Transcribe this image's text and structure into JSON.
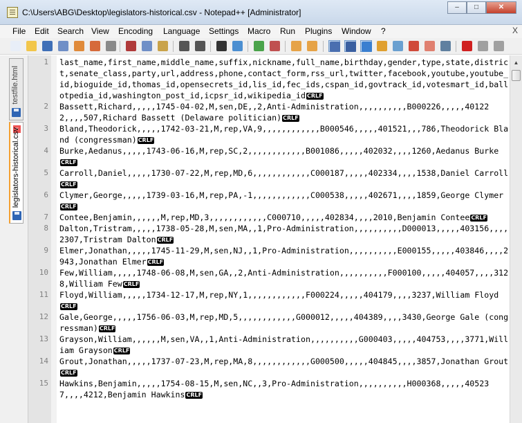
{
  "window": {
    "title": "C:\\Users\\ABG\\Desktop\\legislators-historical.csv - Notepad++ [Administrator]",
    "minimize": "–",
    "maximize": "□",
    "close": "✕"
  },
  "menu": [
    "File",
    "Edit",
    "Search",
    "View",
    "Encoding",
    "Language",
    "Settings",
    "Macro",
    "Run",
    "Plugins",
    "Window",
    "?"
  ],
  "menu_close": "X",
  "toolbar_icons": [
    {
      "name": "new-file-icon",
      "color": "#e8eef8"
    },
    {
      "name": "open-file-icon",
      "color": "#f2c64a"
    },
    {
      "name": "save-icon",
      "color": "#3f6fb7"
    },
    {
      "name": "save-all-icon",
      "color": "#6f8fc7"
    },
    {
      "name": "close-icon",
      "color": "#e08a3a"
    },
    {
      "name": "close-all-icon",
      "color": "#d66a3a"
    },
    {
      "name": "print-icon",
      "color": "#8a8a8a"
    },
    {
      "name": "cut-icon",
      "color": "#b03a3a"
    },
    {
      "name": "copy-icon",
      "color": "#6f8fc7"
    },
    {
      "name": "paste-icon",
      "color": "#c9a34a"
    },
    {
      "name": "undo-icon",
      "color": "#555555"
    },
    {
      "name": "redo-icon",
      "color": "#555555"
    },
    {
      "name": "find-icon",
      "color": "#333333"
    },
    {
      "name": "replace-icon",
      "color": "#4c8fd1"
    },
    {
      "name": "zoom-in-icon",
      "color": "#4aa34a"
    },
    {
      "name": "zoom-out-icon",
      "color": "#c05050"
    },
    {
      "name": "sync-vertical-icon",
      "color": "#e6a347"
    },
    {
      "name": "sync-horizontal-icon",
      "color": "#e6a347"
    },
    {
      "name": "word-wrap-icon",
      "color": "#4a6fb0"
    },
    {
      "name": "show-all-characters-icon",
      "color": "#3a5fa0"
    },
    {
      "name": "indent-guide-icon",
      "color": "#3a7fd0"
    },
    {
      "name": "language-icon",
      "color": "#e0a030"
    },
    {
      "name": "document-map-icon",
      "color": "#6aa0d0"
    },
    {
      "name": "function-list-icon",
      "color": "#d04a3a"
    },
    {
      "name": "folder-workspace-icon",
      "color": "#e08070"
    },
    {
      "name": "monitoring-icon",
      "color": "#6080a0"
    },
    {
      "name": "record-macro-icon",
      "color": "#d02020"
    },
    {
      "name": "stop-macro-icon",
      "color": "#a0a0a0"
    },
    {
      "name": "play-macro-icon",
      "color": "#a0a0a0"
    }
  ],
  "tabs": [
    {
      "label": "testfile.html",
      "active": false
    },
    {
      "label": "legislators-historical.csv",
      "active": true
    }
  ],
  "eol_marker": "CRLF",
  "lines": [
    {
      "n": "1",
      "text": "last_name,first_name,middle_name,suffix,nickname,full_name,birthday,gender,type,state,district,senate_class,party,url,address,phone,contact_form,rss_url,twitter,facebook,youtube,youtube_id,bioguide_id,thomas_id,opensecrets_id,lis_id,fec_ids,cspan_id,govtrack_id,votesmart_id,ballotpedia_id,washington_post_id,icpsr_id,wikipedia_id"
    },
    {
      "n": "2",
      "text": "Bassett,Richard,,,,,1745-04-02,M,sen,DE,,2,Anti-Administration,,,,,,,,,,B000226,,,,,401222,,,,507,Richard Bassett (Delaware politician)"
    },
    {
      "n": "3",
      "text": "Bland,Theodorick,,,,,1742-03-21,M,rep,VA,9,,,,,,,,,,,,B000546,,,,,401521,,,786,Theodorick Bland (congressman)"
    },
    {
      "n": "4",
      "text": "Burke,Aedanus,,,,,1743-06-16,M,rep,SC,2,,,,,,,,,,,,B001086,,,,,402032,,,,1260,Aedanus Burke"
    },
    {
      "n": "5",
      "text": "Carroll,Daniel,,,,,1730-07-22,M,rep,MD,6,,,,,,,,,,,,C000187,,,,,402334,,,,1538,Daniel Carroll"
    },
    {
      "n": "6",
      "text": "Clymer,George,,,,,1739-03-16,M,rep,PA,-1,,,,,,,,,,,,C000538,,,,,402671,,,,1859,George Clymer"
    },
    {
      "n": "7",
      "text": "Contee,Benjamin,,,,,,M,rep,MD,3,,,,,,,,,,,,C000710,,,,,402834,,,,2010,Benjamin Contee"
    },
    {
      "n": "8",
      "text": "Dalton,Tristram,,,,,1738-05-28,M,sen,MA,,1,Pro-Administration,,,,,,,,,,D000013,,,,,403156,,,,2307,Tristram Dalton"
    },
    {
      "n": "9",
      "text": "Elmer,Jonathan,,,,,1745-11-29,M,sen,NJ,,1,Pro-Administration,,,,,,,,,,E000155,,,,,403846,,,,2943,Jonathan Elmer"
    },
    {
      "n": "10",
      "text": "Few,William,,,,,1748-06-08,M,sen,GA,,2,Anti-Administration,,,,,,,,,,F000100,,,,,404057,,,,3128,William Few"
    },
    {
      "n": "11",
      "text": "Floyd,William,,,,,1734-12-17,M,rep,NY,1,,,,,,,,,,,,F000224,,,,,404179,,,,3237,William Floyd"
    },
    {
      "n": "12",
      "text": "Gale,George,,,,,1756-06-03,M,rep,MD,5,,,,,,,,,,,,G000012,,,,,404389,,,,3430,George Gale (congressman)"
    },
    {
      "n": "13",
      "text": "Grayson,William,,,,,,M,sen,VA,,1,Anti-Administration,,,,,,,,,,G000403,,,,,404753,,,,3771,William Grayson"
    },
    {
      "n": "14",
      "text": "Grout,Jonathan,,,,,1737-07-23,M,rep,MA,8,,,,,,,,,,,,G000500,,,,,404845,,,,3857,Jonathan Grout"
    },
    {
      "n": "15",
      "text": "Hawkins,Benjamin,,,,,1754-08-15,M,sen,NC,,3,Pro-Administration,,,,,,,,,,H000368,,,,,405237,,,,4212,Benjamin Hawkins"
    }
  ]
}
